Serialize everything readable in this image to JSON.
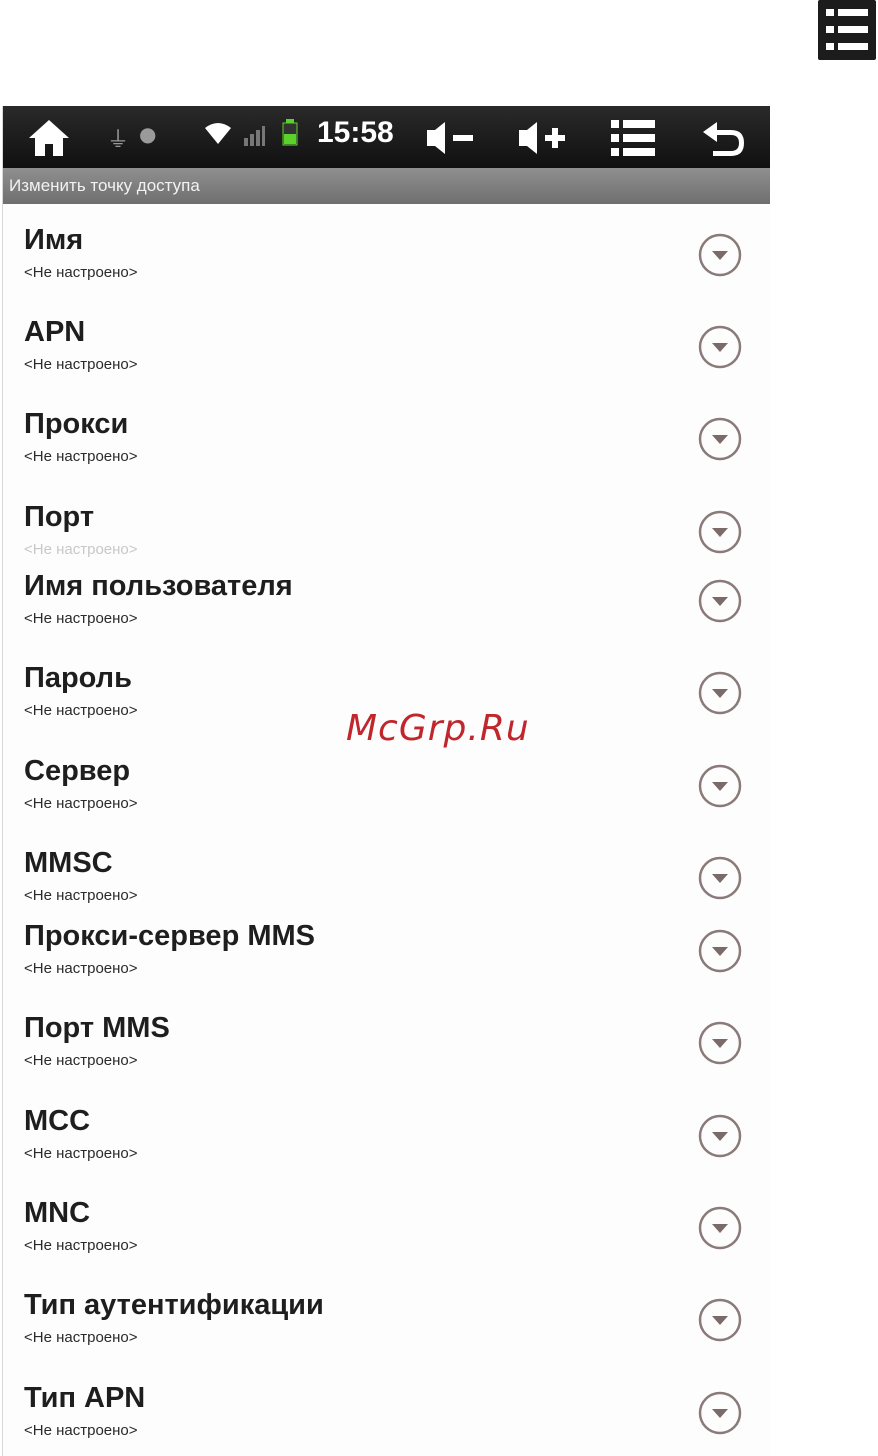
{
  "statusbar": {
    "time": "15:58",
    "icons": [
      "home-icon",
      "usb-icon",
      "android-icon",
      "wifi-icon",
      "signal-icon",
      "battery-icon",
      "volume-down-icon",
      "volume-up-icon",
      "menu-icon",
      "back-icon"
    ]
  },
  "screen_title": "Изменить точку доступа",
  "watermark": "McGrp.Ru",
  "items": [
    {
      "label": "Имя",
      "value": "<Не настроено>"
    },
    {
      "label": "APN",
      "value": "<Не настроено>"
    },
    {
      "label": "Прокси",
      "value": "<Не настроено>"
    },
    {
      "label": "Порт",
      "value": "<Не настроено>"
    },
    {
      "label": "Имя пользователя",
      "value": "<Не настроено>"
    },
    {
      "label": "Пароль",
      "value": "<Не настроено>"
    },
    {
      "label": "Сервер",
      "value": "<Не настроено>"
    },
    {
      "label": "MMSC",
      "value": "<Не настроено>"
    },
    {
      "label": "Прокси-сервер MMS",
      "value": "<Не настроено>"
    },
    {
      "label": "Порт MMS",
      "value": "<Не настроено>"
    },
    {
      "label": "MCC",
      "value": "<Не настроено>"
    },
    {
      "label": "MNC",
      "value": "<Не настроено>"
    },
    {
      "label": "Тип аутентификации",
      "value": "<Не настроено>"
    },
    {
      "label": "Тип APN",
      "value": "<Не настроено>"
    }
  ],
  "colors": {
    "statusbar": "#1a1a1a",
    "titlebar": "#7d7d7d",
    "watermark": "#c0262c",
    "chevron": "#7a6a6a"
  }
}
